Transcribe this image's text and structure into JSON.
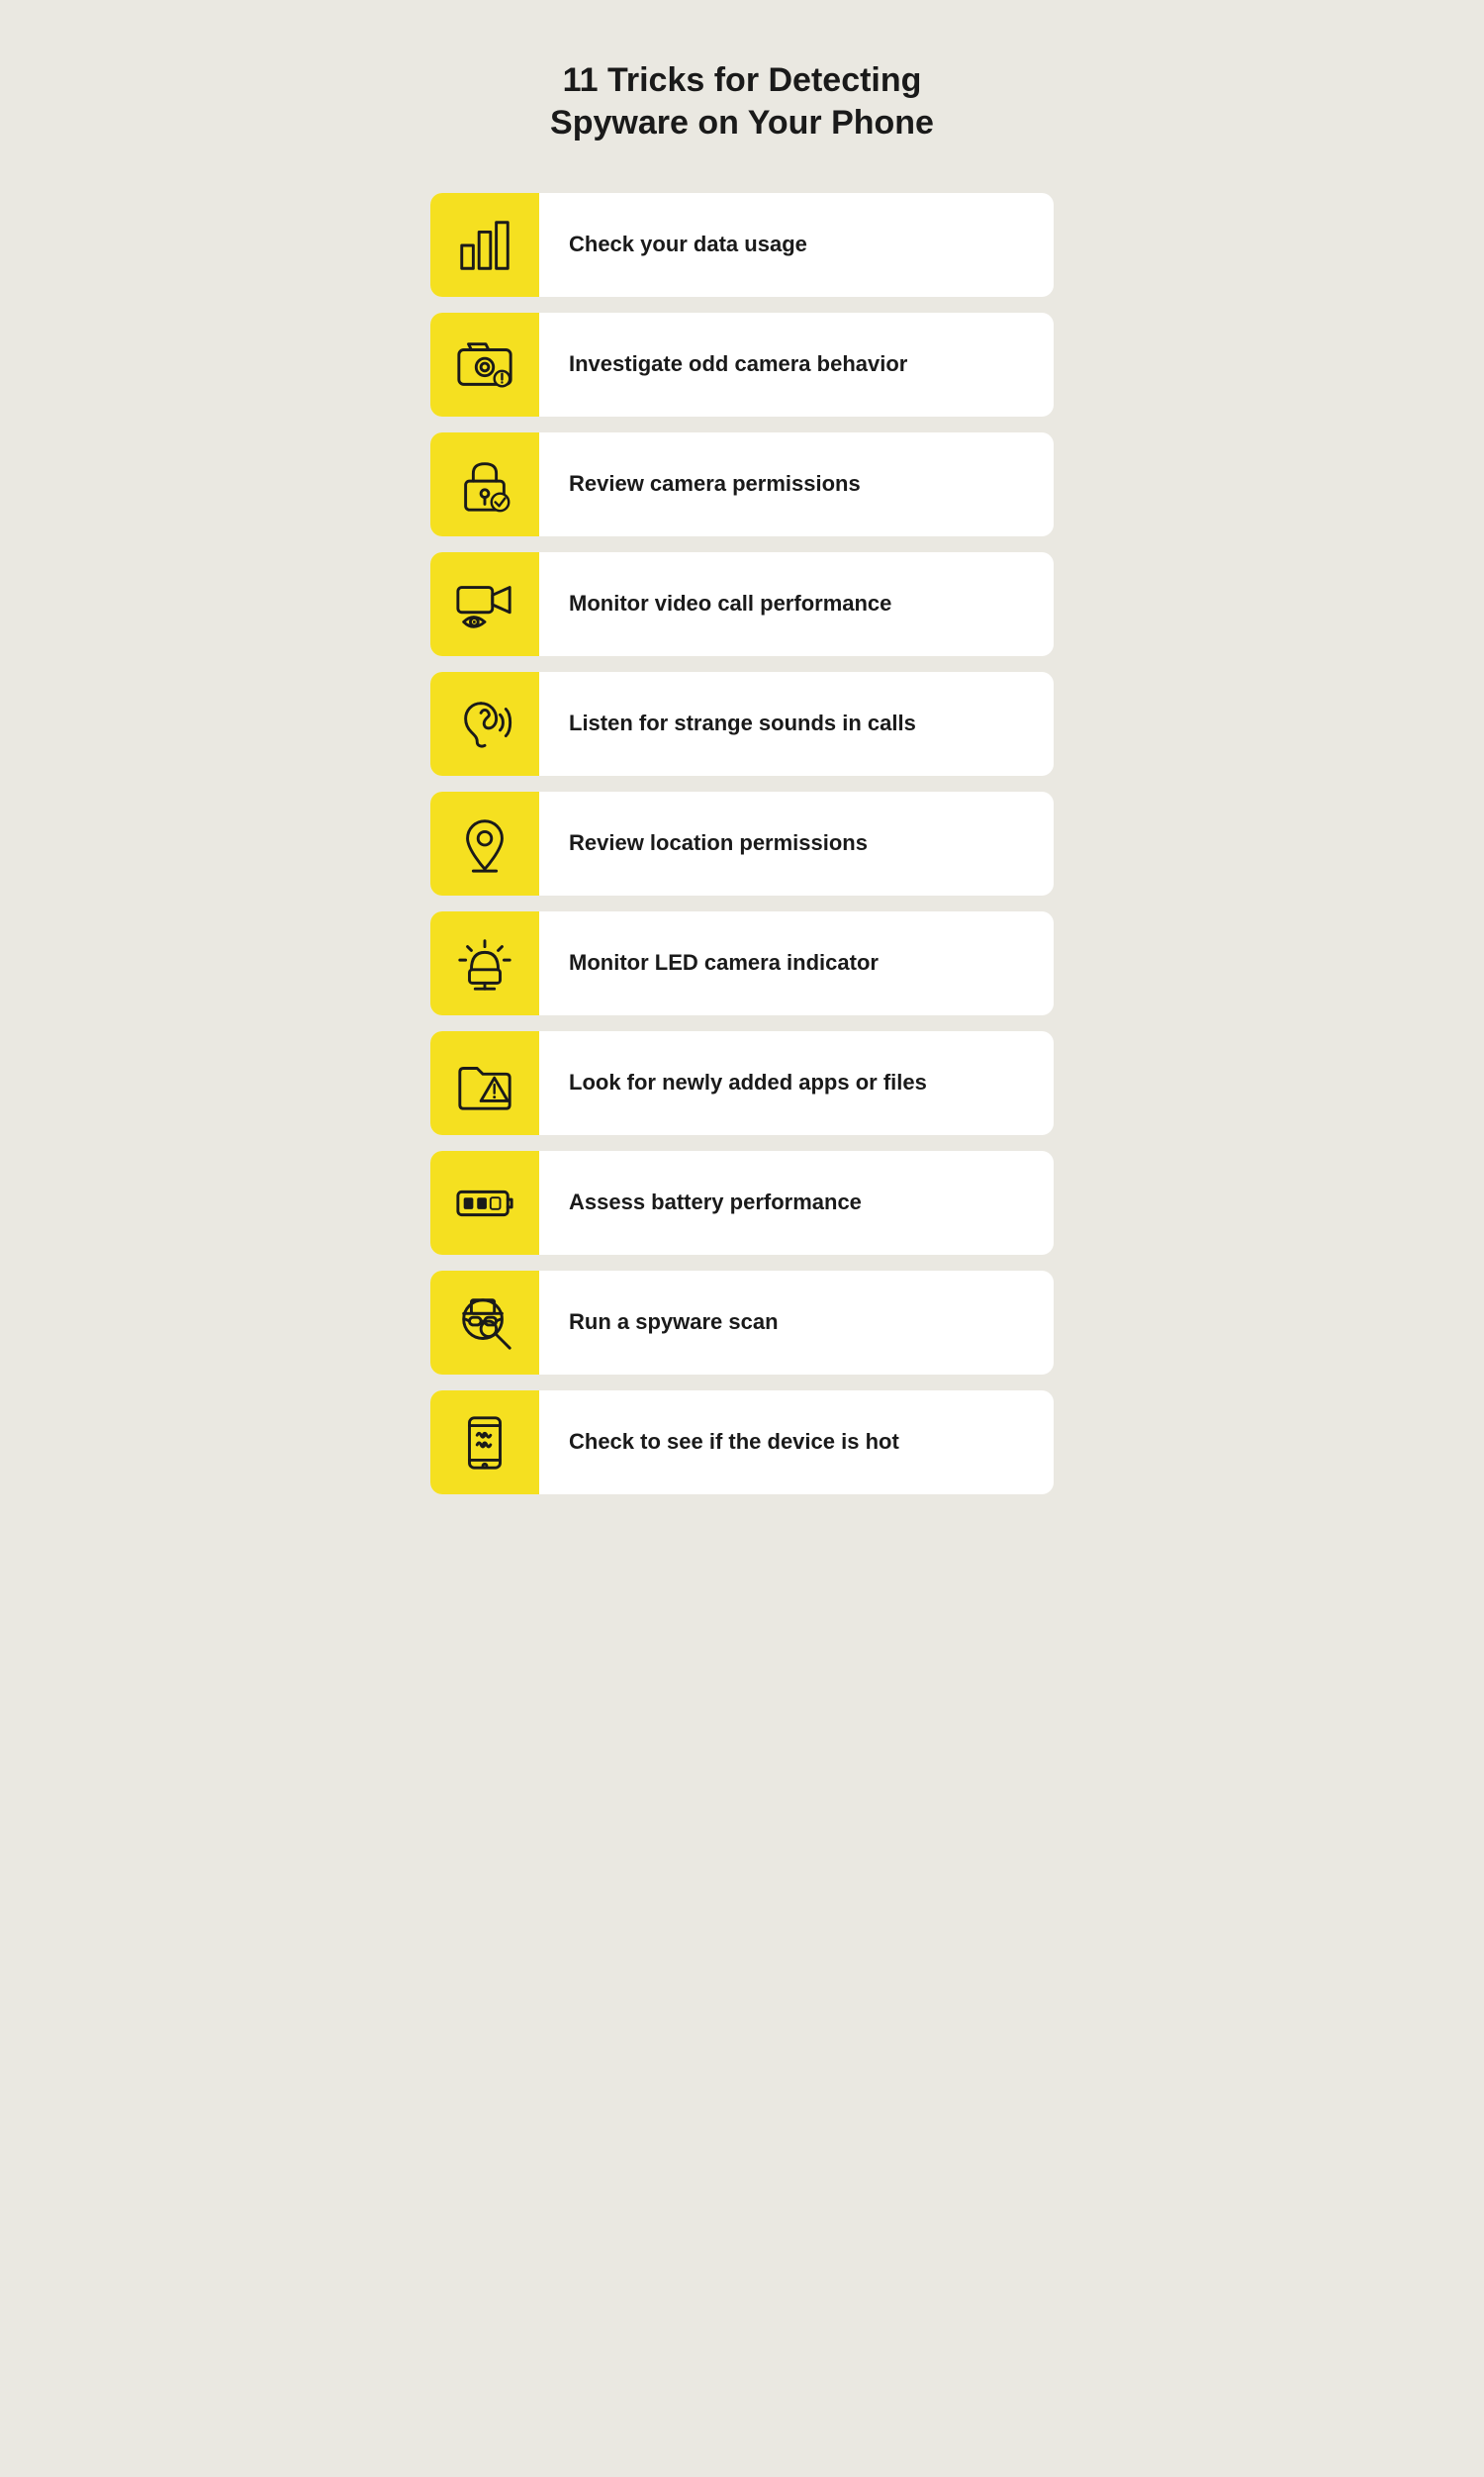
{
  "page": {
    "title_line1": "11 Tricks for Detecting",
    "title_line2": "Spyware on Your Phone",
    "items": [
      {
        "id": "data-usage",
        "label": "Check your data usage",
        "icon": "bar-chart"
      },
      {
        "id": "camera-behavior",
        "label": "Investigate odd camera behavior",
        "icon": "camera-alert"
      },
      {
        "id": "camera-permissions",
        "label": "Review camera permissions",
        "icon": "lock-check"
      },
      {
        "id": "video-call",
        "label": "Monitor video call performance",
        "icon": "video-eye"
      },
      {
        "id": "strange-sounds",
        "label": "Listen for strange sounds in calls",
        "icon": "ear-sound"
      },
      {
        "id": "location-permissions",
        "label": "Review location permissions",
        "icon": "location-pin"
      },
      {
        "id": "led-indicator",
        "label": "Monitor LED camera indicator",
        "icon": "alarm-light"
      },
      {
        "id": "new-apps",
        "label": "Look for newly added apps or files",
        "icon": "folder-alert"
      },
      {
        "id": "battery",
        "label": "Assess battery performance",
        "icon": "battery"
      },
      {
        "id": "spyware-scan",
        "label": "Run a spyware scan",
        "icon": "spy-search"
      },
      {
        "id": "device-hot",
        "label": "Check to see if the device is hot",
        "icon": "phone-hot"
      }
    ]
  }
}
